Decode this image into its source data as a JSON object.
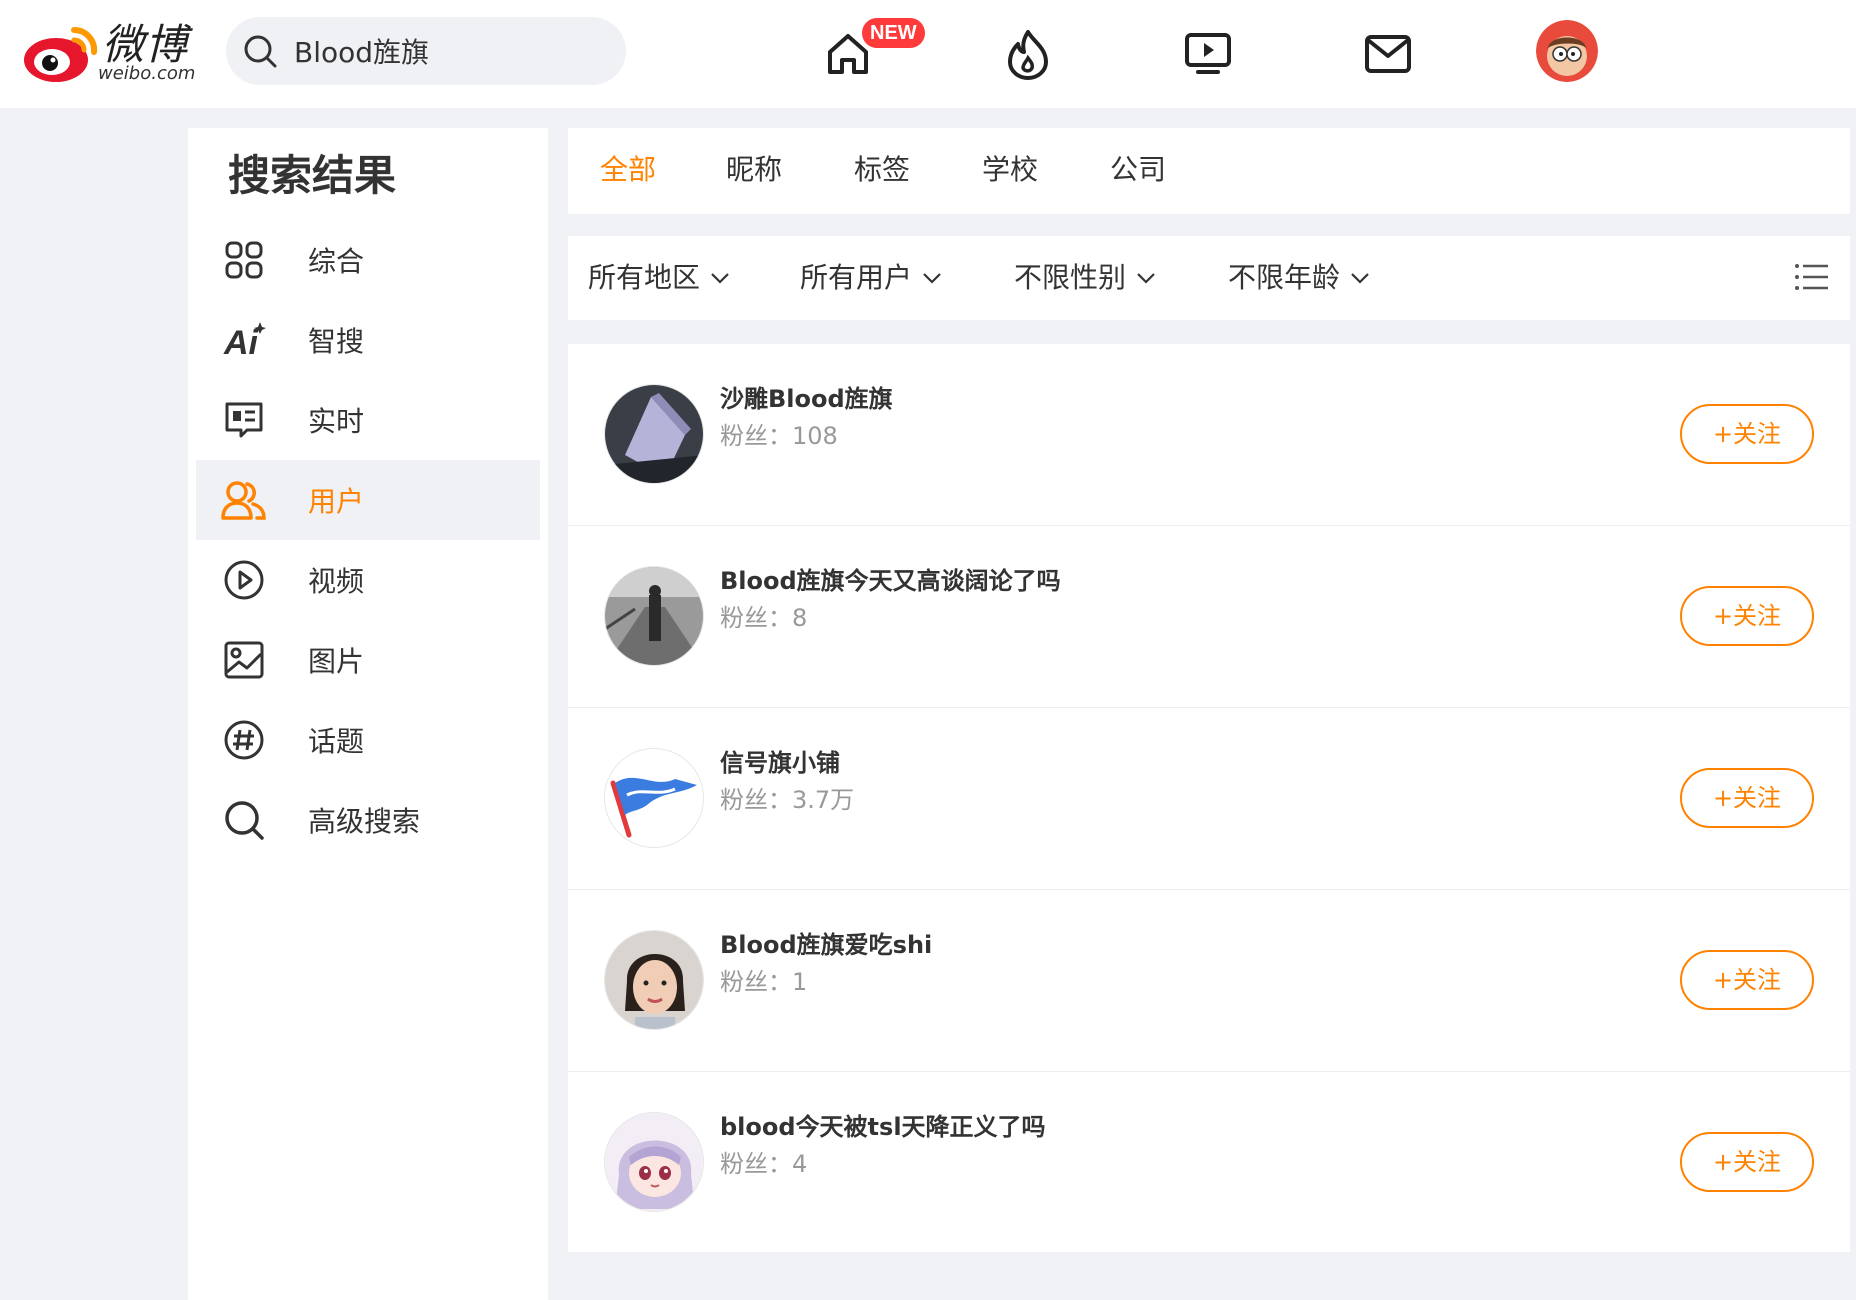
{
  "brand": {
    "name_cn": "微博",
    "name_en": "weibo.com",
    "accent": "#ff8200"
  },
  "search": {
    "query": "Blood旌旗"
  },
  "nav": {
    "home_badge": "NEW",
    "icons": [
      "home-icon",
      "hot-icon",
      "video-icon",
      "mail-icon",
      "avatar"
    ]
  },
  "sidebar": {
    "title": "搜索结果",
    "items": [
      {
        "label": "综合",
        "icon": "grid-icon"
      },
      {
        "label": "智搜",
        "icon": "ai-icon"
      },
      {
        "label": "实时",
        "icon": "realtime-icon"
      },
      {
        "label": "用户",
        "icon": "users-icon",
        "active": true
      },
      {
        "label": "视频",
        "icon": "play-icon"
      },
      {
        "label": "图片",
        "icon": "picture-icon"
      },
      {
        "label": "话题",
        "icon": "hashtag-icon"
      },
      {
        "label": "高级搜索",
        "icon": "search-icon"
      }
    ]
  },
  "tabs": [
    {
      "label": "全部",
      "active": true
    },
    {
      "label": "昵称"
    },
    {
      "label": "标签"
    },
    {
      "label": "学校"
    },
    {
      "label": "公司"
    }
  ],
  "filters": [
    {
      "label": "所有地区"
    },
    {
      "label": "所有用户"
    },
    {
      "label": "不限性别"
    },
    {
      "label": "不限年龄"
    }
  ],
  "results": {
    "fans_label": "粉丝：",
    "follow_label": "+关注",
    "users": [
      {
        "name": "沙雕Blood旌旗",
        "fans": "108"
      },
      {
        "name": "Blood旌旗今天又高谈阔论了吗",
        "fans": "8"
      },
      {
        "name": "信号旗小铺",
        "fans": "3.7万"
      },
      {
        "name": "Blood旌旗爱吃shi",
        "fans": "1"
      },
      {
        "name": "blood今天被tsl天降正义了吗",
        "fans": "4"
      }
    ]
  }
}
